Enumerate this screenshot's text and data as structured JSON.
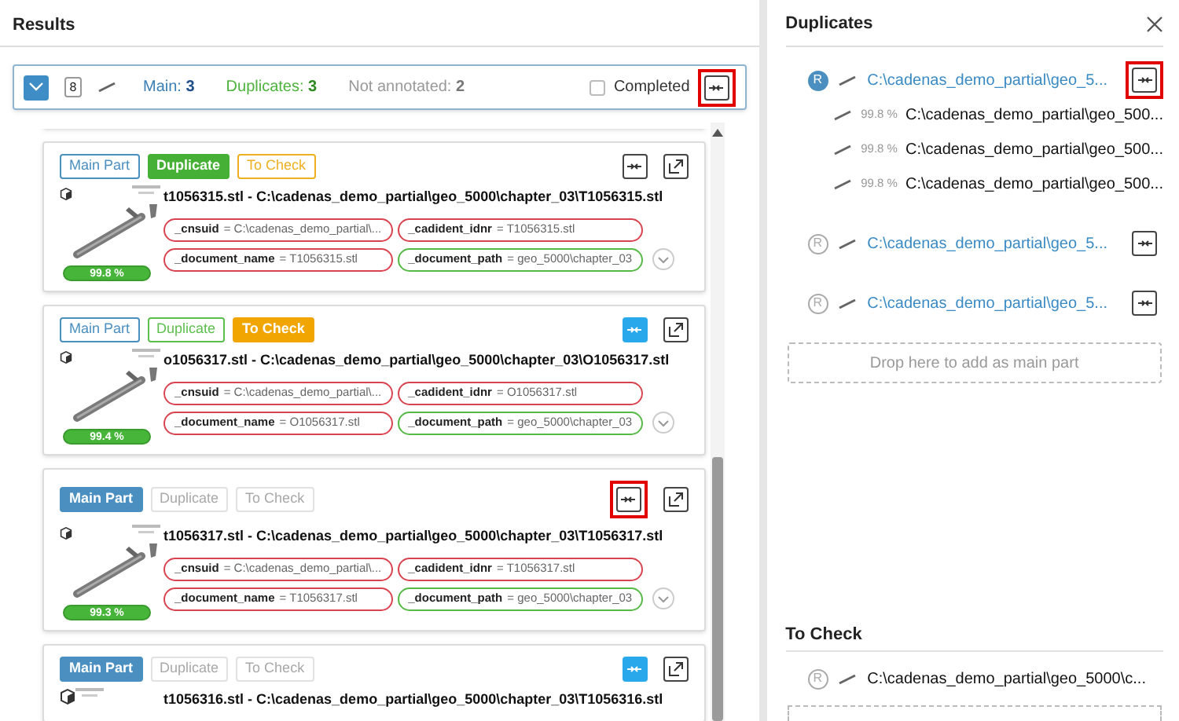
{
  "results": {
    "title": "Results"
  },
  "group": {
    "expanded": true,
    "count": "8",
    "main": {
      "label": "Main:",
      "value": "3"
    },
    "duplicates": {
      "label": "Duplicates:",
      "value": "3"
    },
    "not_annotated": {
      "label": "Not annotated:",
      "value": "2"
    },
    "completed": {
      "label": "Completed",
      "checked": false
    },
    "merge_highlighted": true
  },
  "cards": [
    {
      "tags": [
        {
          "kind": "main",
          "label": "Main Part",
          "selected": false,
          "disabled": false
        },
        {
          "kind": "duplicate",
          "label": "Duplicate",
          "selected": true,
          "disabled": false
        },
        {
          "kind": "check",
          "label": "To Check",
          "selected": false,
          "disabled": false
        }
      ],
      "merge_active": false,
      "merge_highlighted": false,
      "title": "t1056315.stl - C:\\cadenas_demo_partial\\geo_5000\\chapter_03\\T1056315.stl",
      "attributes": [
        {
          "key": "_cnsuid",
          "value": "= C:\\cadenas_demo_partial\\...",
          "color": "#d9434f"
        },
        {
          "key": "_cadident_idnr",
          "value": "= T1056315.stl",
          "color": "#d9434f"
        },
        {
          "key": "_document_name",
          "value": "= T1056315.stl",
          "color": "#d9434f"
        },
        {
          "key": "_document_path",
          "value": "= geo_5000\\chapter_03",
          "color": "#56b946"
        }
      ],
      "score": "99.8 %"
    },
    {
      "tags": [
        {
          "kind": "main",
          "label": "Main Part",
          "selected": false,
          "disabled": false
        },
        {
          "kind": "duplicate",
          "label": "Duplicate",
          "selected": false,
          "disabled": false
        },
        {
          "kind": "check",
          "label": "To Check",
          "selected": true,
          "disabled": false
        }
      ],
      "merge_active": true,
      "merge_highlighted": false,
      "title": "o1056317.stl - C:\\cadenas_demo_partial\\geo_5000\\chapter_03\\O1056317.stl",
      "attributes": [
        {
          "key": "_cnsuid",
          "value": "= C:\\cadenas_demo_partial\\...",
          "color": "#d9434f"
        },
        {
          "key": "_cadident_idnr",
          "value": "= O1056317.stl",
          "color": "#d9434f"
        },
        {
          "key": "_document_name",
          "value": "= O1056317.stl",
          "color": "#d9434f"
        },
        {
          "key": "_document_path",
          "value": "= geo_5000\\chapter_03",
          "color": "#56b946"
        }
      ],
      "score": "99.4 %"
    },
    {
      "tags": [
        {
          "kind": "main",
          "label": "Main Part",
          "selected": true,
          "disabled": false
        },
        {
          "kind": "duplicate",
          "label": "Duplicate",
          "selected": false,
          "disabled": true
        },
        {
          "kind": "check",
          "label": "To Check",
          "selected": false,
          "disabled": true
        }
      ],
      "merge_active": false,
      "merge_highlighted": true,
      "title": "t1056317.stl - C:\\cadenas_demo_partial\\geo_5000\\chapter_03\\T1056317.stl",
      "attributes": [
        {
          "key": "_cnsuid",
          "value": "= C:\\cadenas_demo_partial\\...",
          "color": "#d9434f"
        },
        {
          "key": "_cadident_idnr",
          "value": "= T1056317.stl",
          "color": "#d9434f"
        },
        {
          "key": "_document_name",
          "value": "= T1056317.stl",
          "color": "#d9434f"
        },
        {
          "key": "_document_path",
          "value": "= geo_5000\\chapter_03",
          "color": "#56b946"
        }
      ],
      "score": "99.3 %"
    },
    {
      "tags": [
        {
          "kind": "main",
          "label": "Main Part",
          "selected": true,
          "disabled": false
        },
        {
          "kind": "duplicate",
          "label": "Duplicate",
          "selected": false,
          "disabled": true
        },
        {
          "kind": "check",
          "label": "To Check",
          "selected": false,
          "disabled": true
        }
      ],
      "merge_active": true,
      "merge_highlighted": false,
      "title": "t1056316.stl - C:\\cadenas_demo_partial\\geo_5000\\chapter_03\\T1056316.stl"
    }
  ],
  "duplicates_panel": {
    "title": "Duplicates",
    "items": [
      {
        "badge": "R",
        "main": true,
        "path": "C:\\cadenas_demo_partial\\geo_5...",
        "merge_highlighted": true,
        "children": [
          {
            "score": "99.8 %",
            "path": "C:\\cadenas_demo_partial\\geo_500..."
          },
          {
            "score": "99.8 %",
            "path": "C:\\cadenas_demo_partial\\geo_500..."
          },
          {
            "score": "99.8 %",
            "path": "C:\\cadenas_demo_partial\\geo_500..."
          }
        ]
      },
      {
        "badge": "R",
        "main": false,
        "path": "C:\\cadenas_demo_partial\\geo_5...",
        "merge_highlighted": false
      },
      {
        "badge": "R",
        "main": false,
        "path": "C:\\cadenas_demo_partial\\geo_5...",
        "merge_highlighted": false
      }
    ],
    "drop_zone": "Drop here to add as main part"
  },
  "to_check": {
    "title": "To Check",
    "items": [
      {
        "badge": "R",
        "main": false,
        "path": "C:\\cadenas_demo_partial\\geo_5000\\c..."
      }
    ]
  }
}
